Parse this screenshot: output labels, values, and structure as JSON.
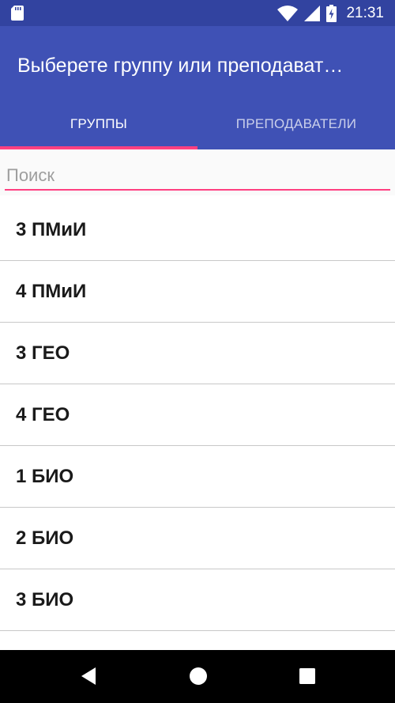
{
  "status_bar": {
    "time": "21:31",
    "icons": [
      "sd-card-icon",
      "wifi-icon",
      "signal-icon",
      "battery-charging-icon"
    ]
  },
  "app_bar": {
    "title": "Выберете группу или преподават…",
    "background": "#3f51b5",
    "status_background": "#3243a0"
  },
  "tabs": [
    {
      "label": "ГРУППЫ",
      "active": true
    },
    {
      "label": "ПРЕПОДАВАТЕЛИ",
      "active": false
    }
  ],
  "accent_color": "#ff4081",
  "search": {
    "placeholder": "Поиск",
    "value": ""
  },
  "list": {
    "items": [
      {
        "label": "3 ПМиИ"
      },
      {
        "label": "4 ПМиИ"
      },
      {
        "label": "3 ГЕО"
      },
      {
        "label": "4 ГЕО"
      },
      {
        "label": "1 БИО"
      },
      {
        "label": "2 БИО"
      },
      {
        "label": "3 БИО"
      }
    ]
  },
  "nav_bar": {
    "buttons": [
      "back-icon",
      "home-icon",
      "recents-icon"
    ]
  }
}
